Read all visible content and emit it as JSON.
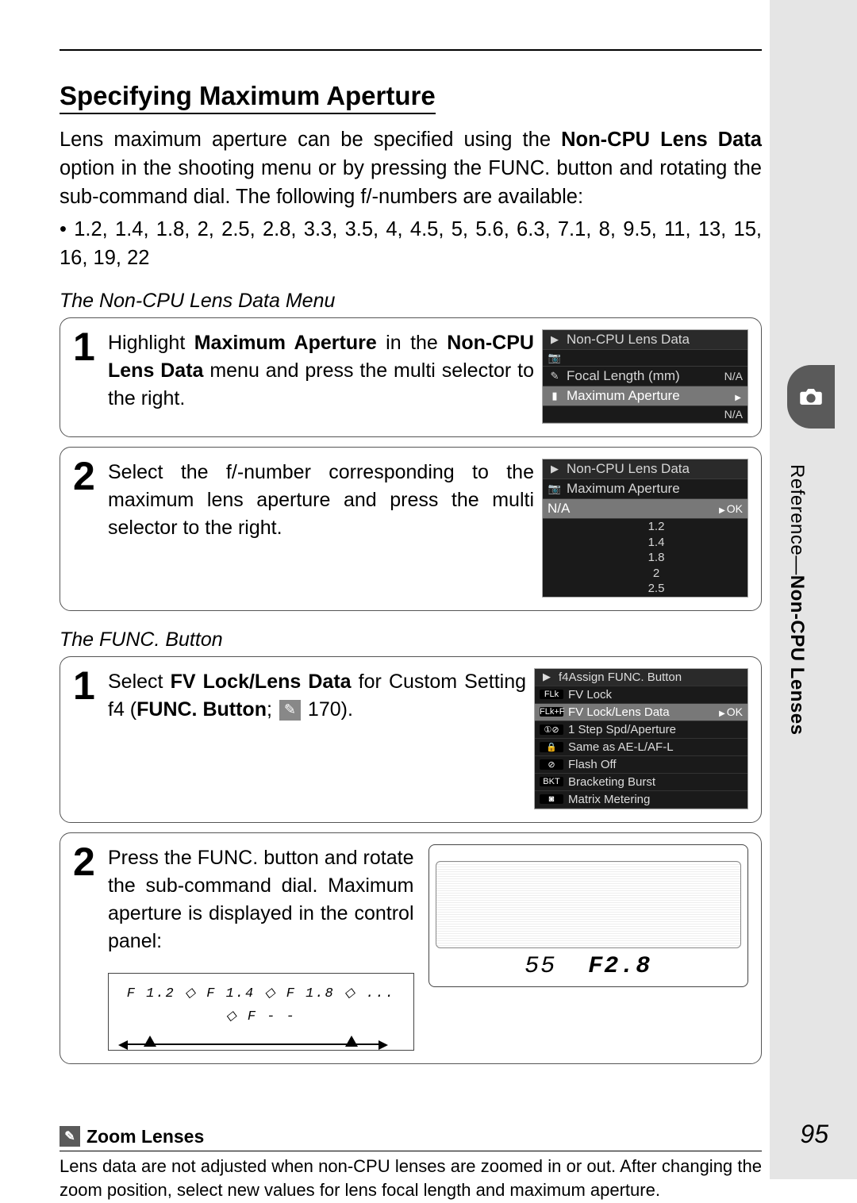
{
  "sidebar": {
    "label_reference": "Reference—",
    "label_section": "Non-CPU Lenses"
  },
  "section_title": "Specifying Maximum Aperture",
  "intro_pre": "Lens maximum aperture can be specified using the ",
  "intro_bold": "Non-CPU Lens Data",
  "intro_post": " option in the shooting menu or by pressing the FUNC. button and rotating the sub-command dial.  The following f/-numbers are available:",
  "fnumbers": "1.2, 1.4, 1.8, 2, 2.5, 2.8, 3.3, 3.5, 4, 4.5, 5, 5.6, 6.3, 7.1, 8, 9.5, 11, 13, 15, 16, 19, 22",
  "subhead_menu": "The Non-CPU Lens Data Menu",
  "menu_step1": {
    "num": "1",
    "t1": "Highlight ",
    "b1": "Maximum Aperture",
    "t2": " in the ",
    "b2": "Non-CPU Lens Data",
    "t3": " menu and press the multi selector to the right."
  },
  "menu_step1_lcd": {
    "title": "Non-CPU Lens Data",
    "row1": "Focal Length (mm)",
    "row1_val": "N/A",
    "row2": "Maximum Aperture",
    "row2_val": "N/A"
  },
  "menu_step2": {
    "num": "2",
    "text": "Select the f/-number corresponding to the maximum lens aperture and press the multi selector to the right."
  },
  "menu_step2_lcd": {
    "title": "Non-CPU Lens Data",
    "sub": "Maximum Aperture",
    "sel": "N/A",
    "ok": "OK",
    "opts": [
      "1.2",
      "1.4",
      "1.8",
      "2",
      "2.5"
    ]
  },
  "subhead_func": "The FUNC. Button",
  "func_step1": {
    "num": "1",
    "t1": "Select ",
    "b1": "FV Lock/Lens Data",
    "t2": " for Custom Setting f4 (",
    "b2": "FUNC. Button",
    "t3": "; ",
    "pageref": "170",
    "t4": ")."
  },
  "func_menu": {
    "title": "f4Assign FUNC. Button",
    "rows": [
      {
        "ic": "FLk",
        "label": "FV Lock"
      },
      {
        "ic": "FLk+F",
        "label": "FV Lock/Lens Data",
        "ok": "OK",
        "sel": true
      },
      {
        "ic": "①⊘",
        "label": "1 Step Spd/Aperture"
      },
      {
        "ic": "🔒",
        "label": "Same as AE-L/AF-L"
      },
      {
        "ic": "⊘",
        "label": "Flash Off"
      },
      {
        "ic": "BKT",
        "label": "Bracketing Burst"
      },
      {
        "ic": "◙",
        "label": "Matrix Metering"
      }
    ]
  },
  "func_step2": {
    "num": "2",
    "text": "Press the FUNC. button and rotate the sub-command dial.  Maximum aperture is displayed in the control panel:"
  },
  "f_sequence": "F 1.2  ◇  F 1.4  ◇  F 1.8  ◇ ... ◇  F - -",
  "panel_readout": {
    "focal": "55",
    "f": "F2.8"
  },
  "note": {
    "title": "Zoom Lenses",
    "body": "Lens data are not adjusted when non-CPU lenses are zoomed in or out.  After changing the zoom position, select new values for lens focal length and maximum aperture."
  },
  "page_number": "95"
}
